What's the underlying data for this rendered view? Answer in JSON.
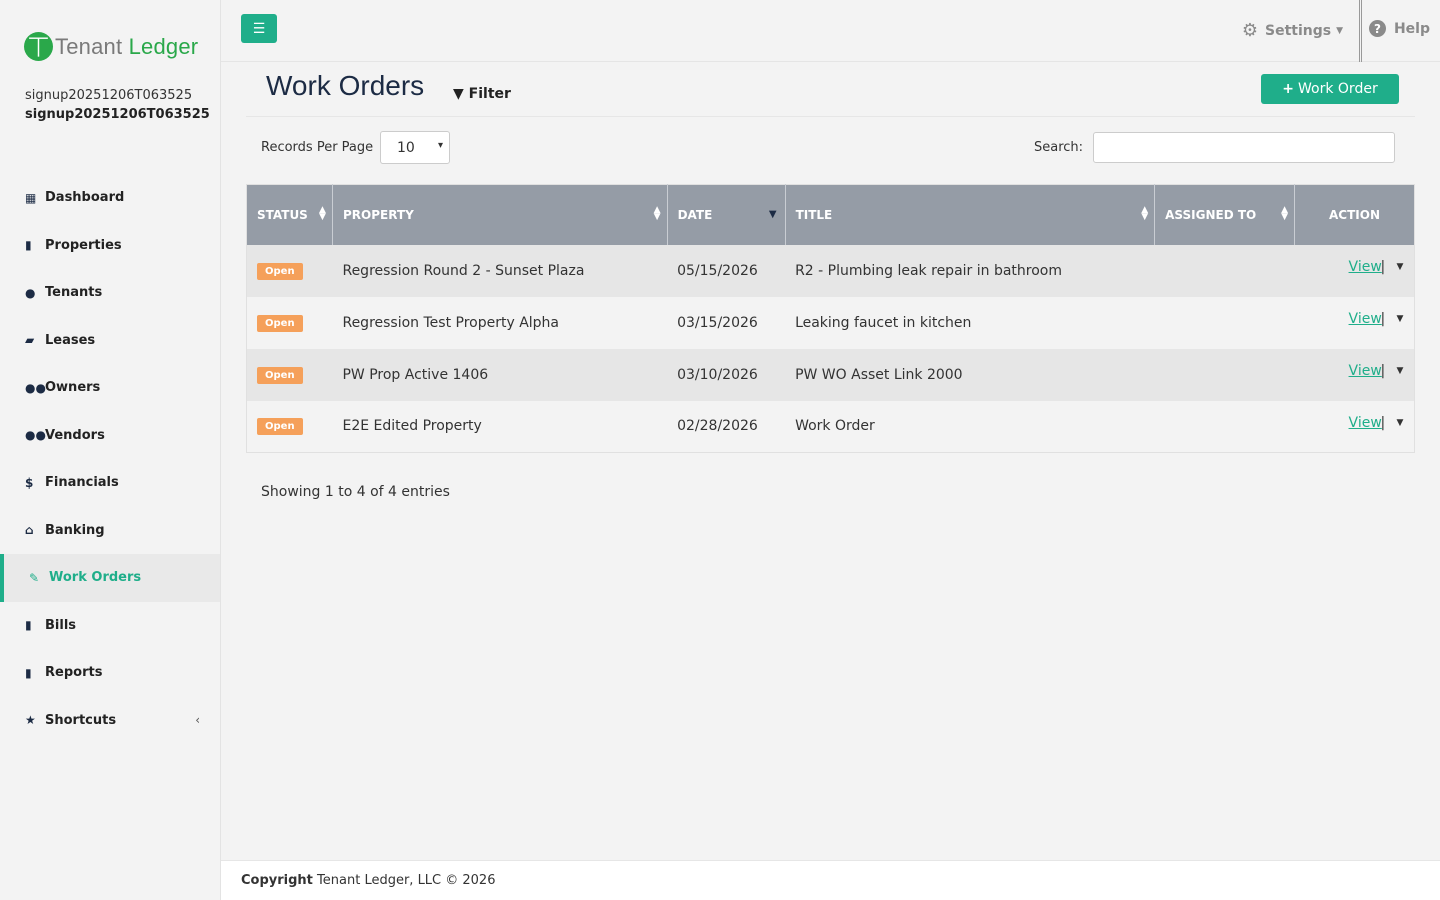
{
  "brand": {
    "part1": "Tenant",
    "part2": "Ledger",
    "logo_glyph": "TL",
    "accent": "#1fae8a",
    "logo_color": "#2aa84a"
  },
  "user": {
    "name": "signup20251206T063525",
    "account": "signup20251206T063525"
  },
  "nav": [
    {
      "label": "Dashboard",
      "icon": "dashboard-icon"
    },
    {
      "label": "Properties",
      "icon": "building-icon"
    },
    {
      "label": "Tenants",
      "icon": "user-icon"
    },
    {
      "label": "Leases",
      "icon": "folder-icon"
    },
    {
      "label": "Owners",
      "icon": "users-icon"
    },
    {
      "label": "Vendors",
      "icon": "users-icon"
    },
    {
      "label": "Financials",
      "icon": "dollar-icon"
    },
    {
      "label": "Banking",
      "icon": "bank-icon"
    },
    {
      "label": "Work Orders",
      "icon": "edit-icon",
      "active": true
    },
    {
      "label": "Bills",
      "icon": "file-icon"
    },
    {
      "label": "Reports",
      "icon": "file-icon"
    },
    {
      "label": "Shortcuts",
      "icon": "star-icon"
    }
  ],
  "topbar": {
    "settings": "Settings",
    "help": "Help"
  },
  "page": {
    "title": "Work Orders",
    "filter": "Filter",
    "add_button": "Work Order",
    "records_per_page_label": "Records Per Page",
    "records_per_page_value": "10",
    "search_label": "Search:",
    "search_value": ""
  },
  "table": {
    "columns": [
      "STATUS",
      "PROPERTY",
      "DATE",
      "TITLE",
      "ASSIGNED TO",
      "ACTION"
    ],
    "rows": [
      {
        "status": "Open",
        "property": "Regression Round 2 - Sunset Plaza",
        "date": "05/15/2026",
        "title": "R2 - Plumbing leak repair in bathroom",
        "assigned": "",
        "action": "View"
      },
      {
        "status": "Open",
        "property": "Regression Test Property Alpha",
        "date": "03/15/2026",
        "title": "Leaking faucet in kitchen",
        "assigned": "",
        "action": "View"
      },
      {
        "status": "Open",
        "property": "PW Prop Active 1406",
        "date": "03/10/2026",
        "title": "PW WO Asset Link 2000",
        "assigned": "",
        "action": "View"
      },
      {
        "status": "Open",
        "property": "E2E Edited Property",
        "date": "02/28/2026",
        "title": "Work Order",
        "assigned": "",
        "action": "View"
      }
    ]
  },
  "pagination": {
    "info": "Showing 1 to 4 of 4 entries"
  },
  "footer": {
    "bold": "Copyright",
    "text": " Tenant Ledger, LLC © 2026"
  }
}
